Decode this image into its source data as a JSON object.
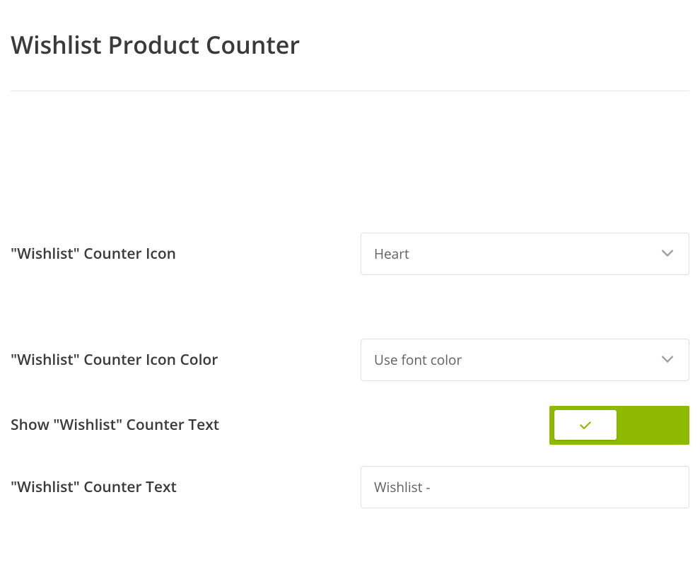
{
  "title": "Wishlist Product Counter",
  "fields": {
    "counter_icon": {
      "label": "\"Wishlist\" Counter Icon",
      "value": "Heart"
    },
    "counter_icon_color": {
      "label": "\"Wishlist\" Counter Icon Color",
      "value": "Use font color"
    },
    "show_counter_text": {
      "label": "Show \"Wishlist\" Counter Text",
      "enabled": true
    },
    "counter_text": {
      "label": "\"Wishlist\" Counter Text",
      "value": "Wishlist -"
    }
  },
  "colors": {
    "accent": "#8db900",
    "text_dark": "#3a3a3a",
    "text_muted": "#616161",
    "border": "#e0e0e0"
  }
}
